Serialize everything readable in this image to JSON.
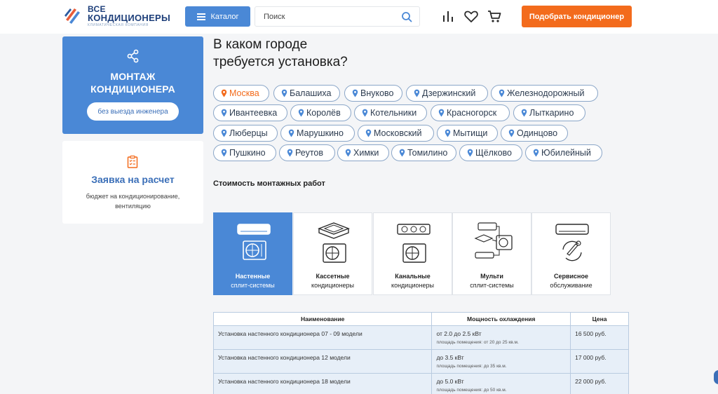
{
  "header": {
    "logo": {
      "line1": "ВСЕ",
      "line2": "КОНДИЦИОНЕРЫ",
      "tagline": "КЛИМАТИЧЕСКАЯ КОМПАНИЯ"
    },
    "catalog_label": "Каталог",
    "search_placeholder": "Поиск",
    "pick_button": "Подобрать кондиционер",
    "icons": [
      "compare-icon",
      "heart-icon",
      "cart-icon",
      "search-icon",
      "menu-icon"
    ]
  },
  "sidebar": {
    "install_card": {
      "title_line1": "МОНТАЖ",
      "title_line2": "КОНДИЦИОНЕРА",
      "button": "без выезда инженера",
      "icon": "share-icon"
    },
    "request_card": {
      "title": "Заявка на расчет",
      "desc_line1": "бюджет на кондиционирование,",
      "desc_line2": "вентиляцию",
      "icon": "checklist-icon"
    }
  },
  "main": {
    "heading_line1": "В каком городе",
    "heading_line2": "требуется установка?",
    "cities": [
      "Москва",
      "Балашиха",
      "Внуково",
      "Дзержинский",
      "Железнодорожный",
      "Ивантеевка",
      "Королёв",
      "Котельники",
      "Красногорск",
      "Лыткарино",
      "Люберцы",
      "Марушкино",
      "Московский",
      "Мытищи",
      "Одинцово",
      "Пушкино",
      "Реутов",
      "Химки",
      "Томилино",
      "Щёлково",
      "Юбилейный"
    ],
    "active_city": "Москва",
    "cost_title": "Стоимость монтажных работ",
    "types": [
      {
        "l1": "Настенные",
        "l2": "сплит-системы",
        "active": true
      },
      {
        "l1": "Кассетные",
        "l2": "кондиционеры",
        "active": false
      },
      {
        "l1": "Канальные",
        "l2": "кондиционеры",
        "active": false
      },
      {
        "l1": "Мульти",
        "l2": "сплит-системы",
        "active": false
      },
      {
        "l1": "Сервисное",
        "l2": "обслуживание",
        "active": false
      }
    ],
    "table": {
      "headers": [
        "Наименование",
        "Мощность охлаждения",
        "Цена"
      ],
      "rows": [
        {
          "name": "Установка настенного кондиционера 07 - 09 модели",
          "power": "от 2.0 до 2.5 кВт",
          "area": "площадь помещения: от 20 до 25 кв.м.",
          "price": "16 500 руб."
        },
        {
          "name": "Установка настенного кондиционера 12 модели",
          "power": "до 3.5 кВт",
          "area": "площадь помещения: до 35 кв.м.",
          "price": "17 000 руб."
        },
        {
          "name": "Установка настенного кондиционера 18 модели",
          "power": "до 5.0 кВт",
          "area": "площадь помещения: до 50 кв.м.",
          "price": "22 000 руб."
        }
      ]
    }
  },
  "colors": {
    "accent_blue": "#4a88d6",
    "accent_orange": "#f36b1c",
    "heading_blue": "#3b6fb8"
  }
}
